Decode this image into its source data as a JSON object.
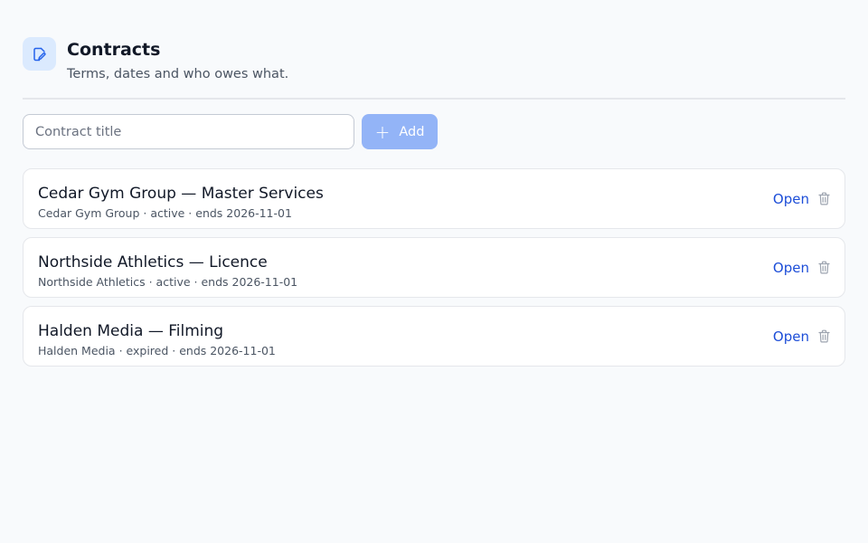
{
  "header": {
    "icon": "edit-document-icon",
    "title": "Contracts",
    "subtitle": "Terms, dates and who owes what."
  },
  "form": {
    "input_placeholder": "Contract title",
    "input_value": "",
    "add_label": "Add",
    "add_icon": "plus-icon"
  },
  "contracts": [
    {
      "title": "Cedar Gym Group — Master Services",
      "meta": "Cedar Gym Group · active · ends 2026-11-01",
      "open_label": "Open",
      "delete_icon": "trash-icon"
    },
    {
      "title": "Northside Athletics — Licence",
      "meta": "Northside Athletics · active · ends 2026-11-01",
      "open_label": "Open",
      "delete_icon": "trash-icon"
    },
    {
      "title": "Halden Media — Filming",
      "meta": "Halden Media · expired · ends 2026-11-01",
      "open_label": "Open",
      "delete_icon": "trash-icon"
    }
  ],
  "colors": {
    "background": "#f8fafc",
    "accent": "#1d4ed8",
    "add_button": "#93b4f7",
    "icon_tile": "#dbeafe"
  }
}
